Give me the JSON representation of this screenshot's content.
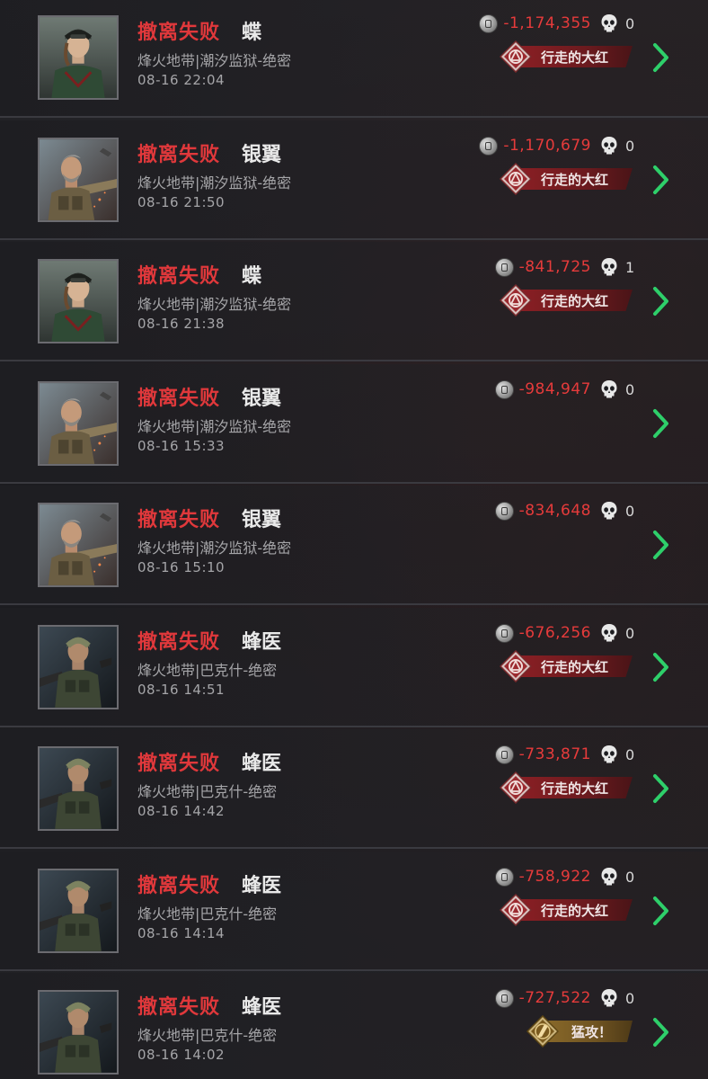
{
  "colors": {
    "status_red": "#e0383b",
    "value_red": "#e63b3b",
    "chevron_green": "#2ecf6a",
    "badge_red": "#8a1f24",
    "badge_gold": "#8a6a2a"
  },
  "icons": {
    "coin": "silver-coin-icon",
    "kills": "skull-icon",
    "arrow": "chevron-right-icon"
  },
  "records": [
    {
      "status": "撤离失败",
      "operator": "蝶",
      "avatar": "female-soldier",
      "map": "烽火地带|潮汐监狱-绝密",
      "time": "08-16 22:04",
      "value": "-1,174,355",
      "kills": "0",
      "badge": "行走的大红",
      "badge_type": "red"
    },
    {
      "status": "撤离失败",
      "operator": "银翼",
      "avatar": "silver-wing",
      "map": "烽火地带|潮汐监狱-绝密",
      "time": "08-16 21:50",
      "value": "-1,170,679",
      "kills": "0",
      "badge": "行走的大红",
      "badge_type": "red"
    },
    {
      "status": "撤离失败",
      "operator": "蝶",
      "avatar": "female-soldier",
      "map": "烽火地带|潮汐监狱-绝密",
      "time": "08-16 21:38",
      "value": "-841,725",
      "kills": "1",
      "badge": "行走的大红",
      "badge_type": "red"
    },
    {
      "status": "撤离失败",
      "operator": "银翼",
      "avatar": "silver-wing",
      "map": "烽火地带|潮汐监狱-绝密",
      "time": "08-16 15:33",
      "value": "-984,947",
      "kills": "0",
      "badge": "",
      "badge_type": "none"
    },
    {
      "status": "撤离失败",
      "operator": "银翼",
      "avatar": "silver-wing",
      "map": "烽火地带|潮汐监狱-绝密",
      "time": "08-16 15:10",
      "value": "-834,648",
      "kills": "0",
      "badge": "",
      "badge_type": "none"
    },
    {
      "status": "撤离失败",
      "operator": "蜂医",
      "avatar": "medic",
      "map": "烽火地带|巴克什-绝密",
      "time": "08-16 14:51",
      "value": "-676,256",
      "kills": "0",
      "badge": "行走的大红",
      "badge_type": "red"
    },
    {
      "status": "撤离失败",
      "operator": "蜂医",
      "avatar": "medic",
      "map": "烽火地带|巴克什-绝密",
      "time": "08-16 14:42",
      "value": "-733,871",
      "kills": "0",
      "badge": "行走的大红",
      "badge_type": "red"
    },
    {
      "status": "撤离失败",
      "operator": "蜂医",
      "avatar": "medic",
      "map": "烽火地带|巴克什-绝密",
      "time": "08-16 14:14",
      "value": "-758,922",
      "kills": "0",
      "badge": "行走的大红",
      "badge_type": "red"
    },
    {
      "status": "撤离失败",
      "operator": "蜂医",
      "avatar": "medic",
      "map": "烽火地带|巴克什-绝密",
      "time": "08-16 14:02",
      "value": "-727,522",
      "kills": "0",
      "badge": "猛攻！",
      "badge_type": "gold"
    }
  ]
}
